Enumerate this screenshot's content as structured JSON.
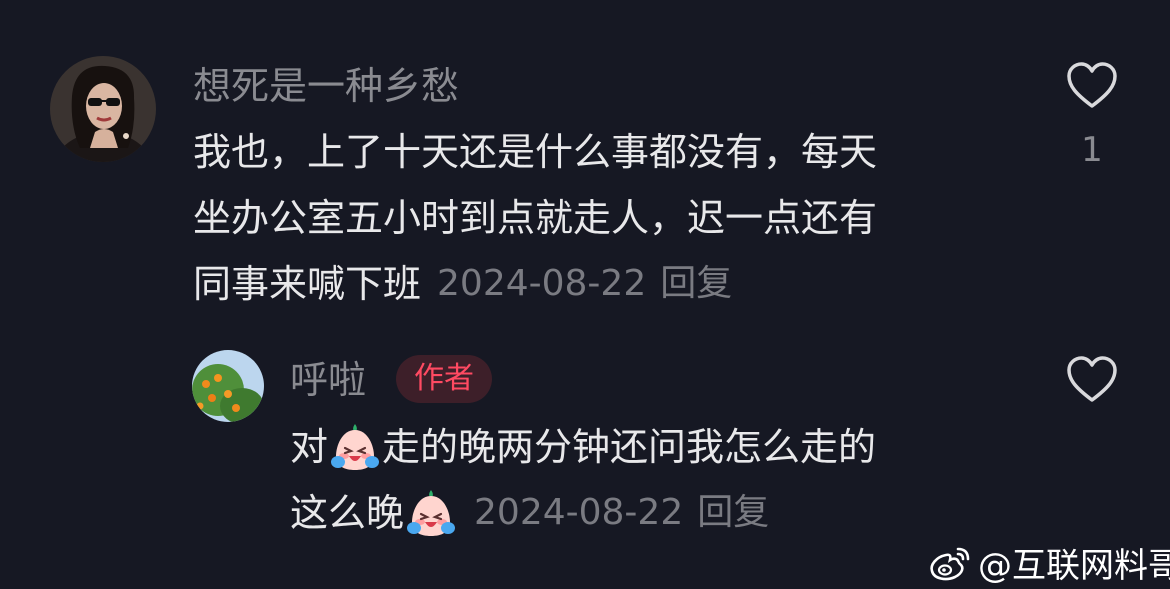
{
  "comment": {
    "username": "想死是一种乡愁",
    "lines": [
      "我也，上了十天还是什么事都没有，每天",
      "坐办公室五小时到点就走人，迟一点还有",
      "同事来喊下班"
    ],
    "date": "2024-08-22",
    "reply_label": "回复",
    "like_count": "1",
    "like_icon": "heart-outline-icon"
  },
  "reply": {
    "username": "呼啦",
    "author_badge": "作者",
    "line1_a": "对",
    "line1_b": "走的晚两分钟还问我怎么走的",
    "line2_a": "这么晚",
    "emoji": "crying-laughing-face-emoji",
    "date": "2024-08-22",
    "reply_label": "回复",
    "like_icon": "heart-outline-icon"
  },
  "watermark": {
    "text": "@互联网料哥",
    "icon": "weibo-logo-icon"
  },
  "colors": {
    "background": "#161823",
    "badge_text": "#ff4a62",
    "badge_bg": "#3d1f29"
  }
}
